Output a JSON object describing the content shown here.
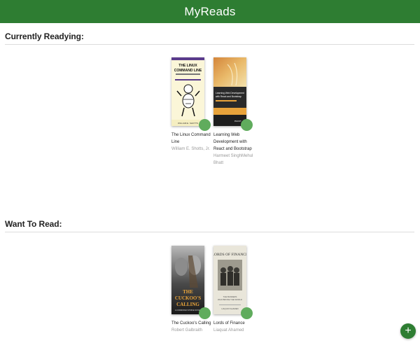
{
  "header": {
    "title": "MyReads"
  },
  "shelves": [
    {
      "title": "Currently Readying:",
      "books": [
        {
          "title": "The Linux Command Line",
          "authors": "William E. Shotts, Jr.",
          "cover_text": "THE LINUX COMMAND LINE"
        },
        {
          "title": "Learning Web Development with React and Bootstrap",
          "authors": "Harmeet SinghMehul Bhatt",
          "cover_text": "Learning Web Development with React and Bootstrap"
        }
      ]
    },
    {
      "title": "Want To Read:",
      "books": [
        {
          "title": "The Cuckoo's Calling",
          "authors": "Robert Galbraith",
          "cover_text": "THE CUCKOO'S CALLING"
        },
        {
          "title": "Lords of Finance",
          "authors": "Liaquat Ahamed",
          "cover_text": "LORDS OF FINANCE"
        }
      ]
    }
  ],
  "add_button": {
    "icon": "plus-icon",
    "symbol": "+"
  },
  "colors": {
    "header": "#2e7d32",
    "shelf_changer": "#60ac5d"
  }
}
